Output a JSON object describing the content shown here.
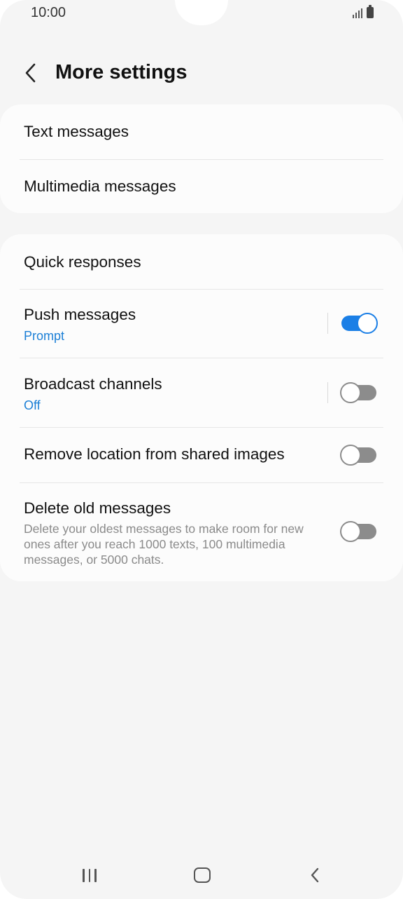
{
  "status_bar": {
    "time": "10:00",
    "icons": [
      "signal-icon",
      "battery-icon"
    ]
  },
  "header": {
    "back_icon": "chevron-left-icon",
    "title": "More settings"
  },
  "group_1": {
    "items": [
      {
        "label": "Text messages"
      },
      {
        "label": "Multimedia messages"
      }
    ]
  },
  "group_2": {
    "quick_responses": {
      "label": "Quick responses"
    },
    "push_messages": {
      "label": "Push messages",
      "sub": "Prompt",
      "toggle": true
    },
    "broadcast_channels": {
      "label": "Broadcast channels",
      "sub": "Off",
      "toggle": false
    },
    "remove_location": {
      "label": "Remove location from shared images",
      "toggle": false
    },
    "delete_old": {
      "label": "Delete old messages",
      "description": "Delete your oldest messages to make room for new ones after you reach 1000 texts, 100 multimedia messages, or 5000 chats.",
      "toggle": false
    }
  },
  "nav_bar": {
    "icons": [
      "recents-icon",
      "home-icon",
      "back-icon"
    ]
  },
  "colors": {
    "accent": "#1b7fe6",
    "sub_text": "#1b7fd6",
    "toggle_off": "#8c8c8c",
    "background": "#f5f5f5",
    "card": "#fcfcfc"
  }
}
